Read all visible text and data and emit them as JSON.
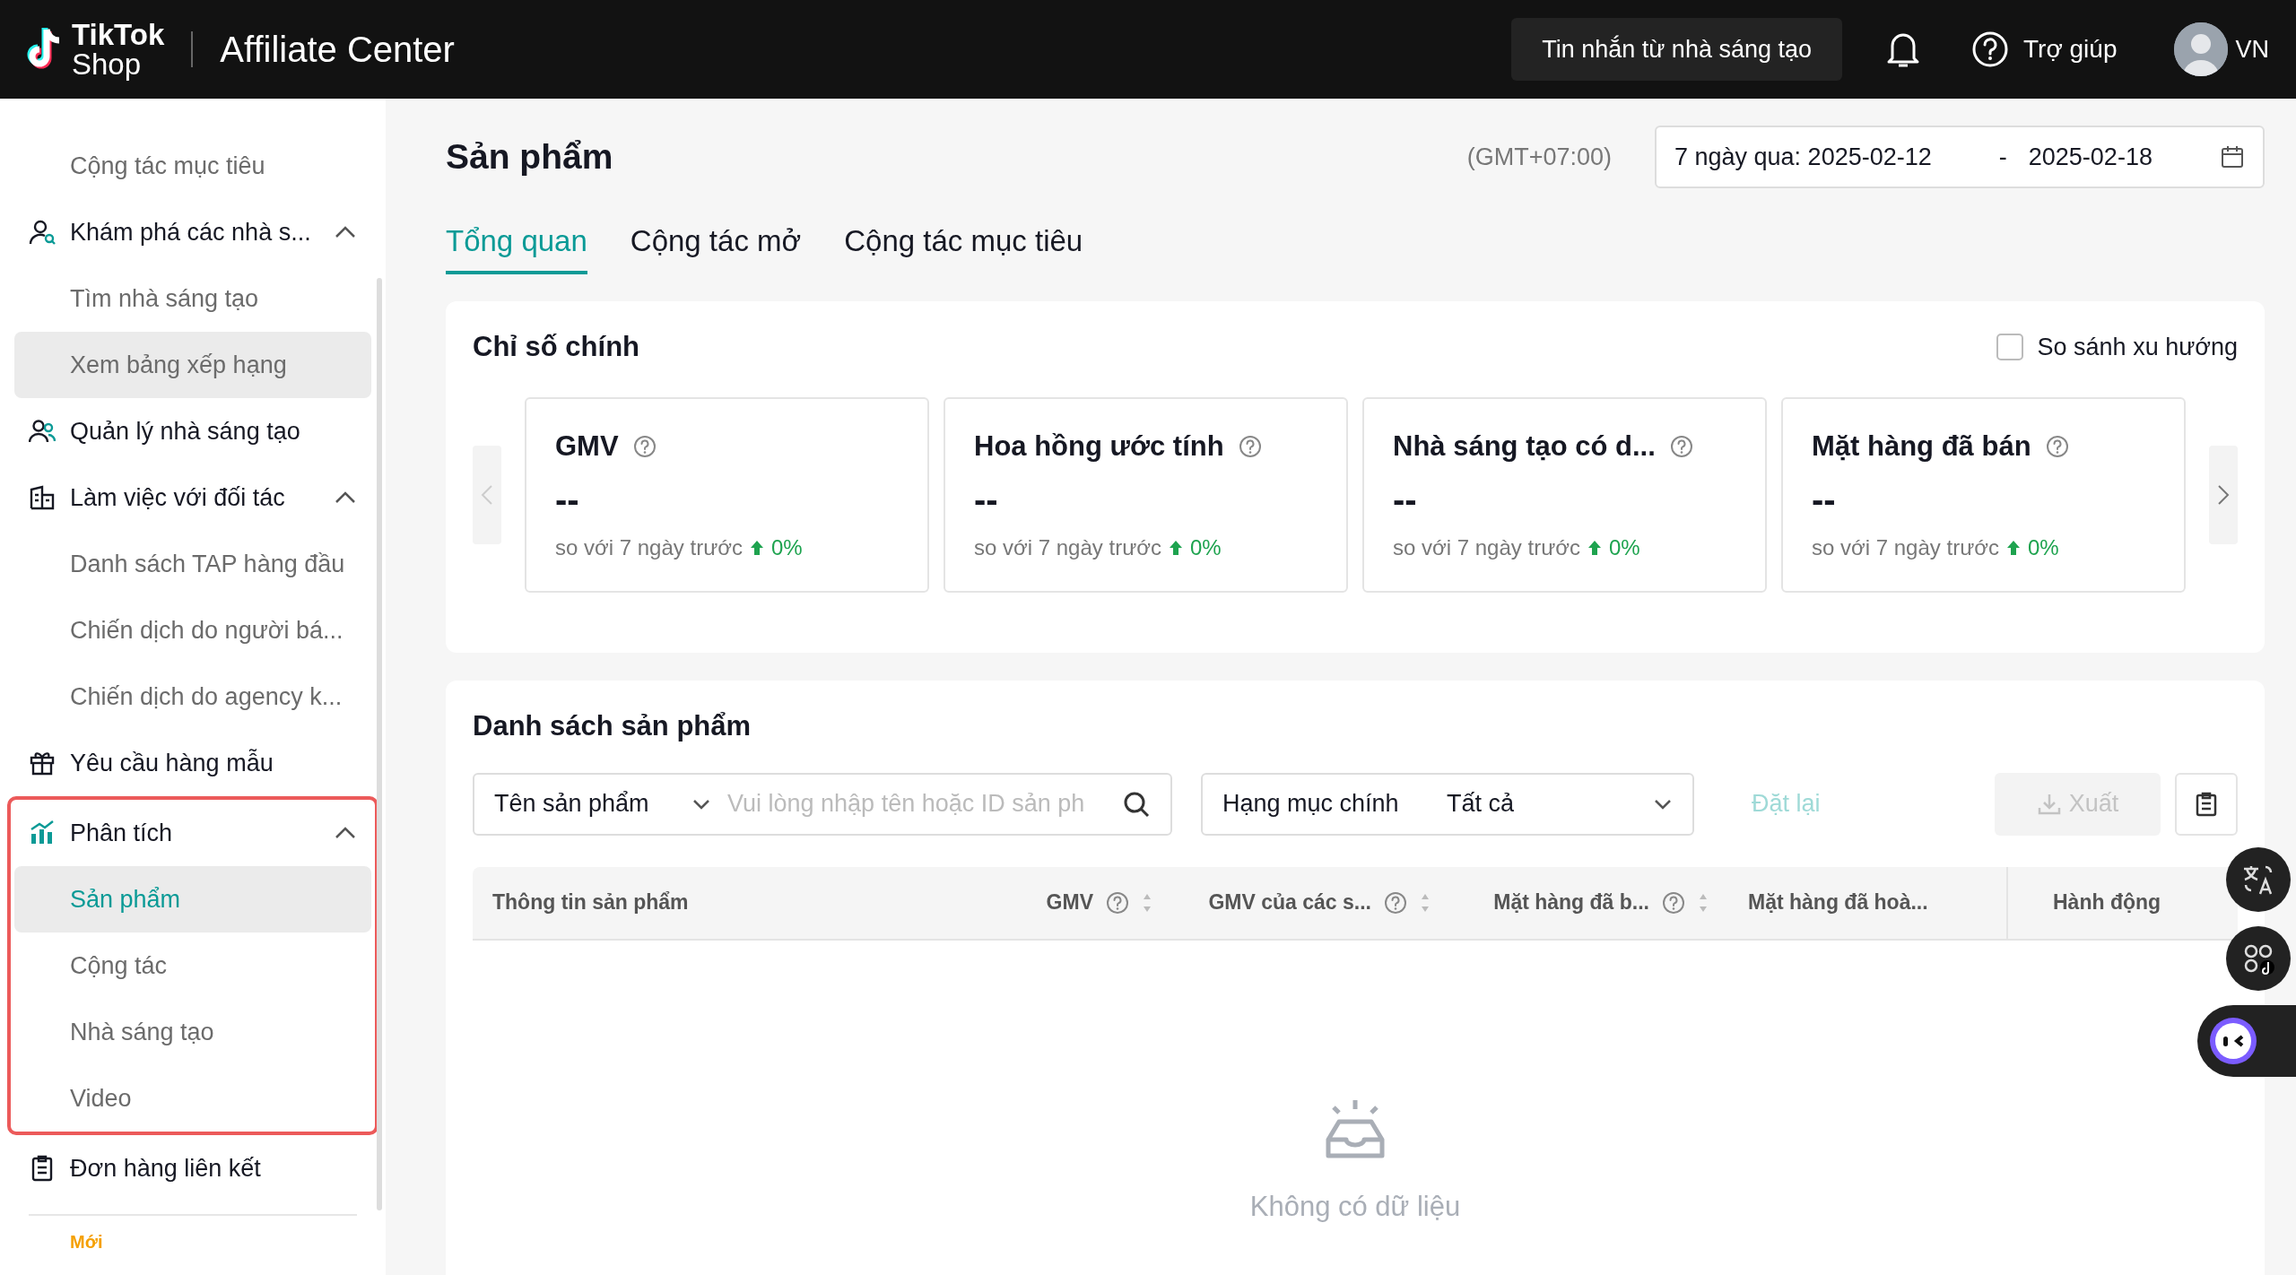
{
  "topbar": {
    "brand_top": "TikTok",
    "brand_bottom": "Shop",
    "app_title": "Affiliate Center",
    "messages_button": "Tin nhắn từ nhà sáng tạo",
    "help": "Trợ giúp",
    "region": "VN"
  },
  "sidebar": {
    "items": [
      {
        "kind": "sub",
        "label": "Cộng tác mục tiêu",
        "selected": false,
        "hovered": false
      },
      {
        "kind": "group",
        "label": "Khám phá các nhà s...",
        "expanded": true,
        "framed": false,
        "children": [
          {
            "label": "Tìm nhà sáng tạo",
            "selected": false,
            "hovered": false
          },
          {
            "label": "Xem bảng xếp hạng",
            "selected": false,
            "hovered": true
          }
        ]
      },
      {
        "kind": "link",
        "label": "Quản lý nhà sáng tạo"
      },
      {
        "kind": "group",
        "label": "Làm việc với đối tác",
        "expanded": true,
        "framed": false,
        "children": [
          {
            "label": "Danh sách TAP hàng đầu",
            "selected": false,
            "hovered": false
          },
          {
            "label": "Chiến dịch do người bá...",
            "selected": false,
            "hovered": false
          },
          {
            "label": "Chiến dịch do agency k...",
            "selected": false,
            "hovered": false
          }
        ]
      },
      {
        "kind": "link",
        "label": "Yêu cầu hàng mẫu"
      },
      {
        "kind": "group",
        "label": "Phân tích",
        "expanded": true,
        "framed": true,
        "children": [
          {
            "label": "Sản phẩm",
            "selected": true,
            "hovered": false
          },
          {
            "label": "Cộng tác",
            "selected": false,
            "hovered": false
          },
          {
            "label": "Nhà sáng tạo",
            "selected": false,
            "hovered": false
          },
          {
            "label": "Video",
            "selected": false,
            "hovered": false
          }
        ]
      },
      {
        "kind": "link",
        "label": "Đơn hàng liên kết"
      }
    ],
    "new_badge": "Mới"
  },
  "page": {
    "title": "Sản phẩm",
    "timezone": "(GMT+07:00)",
    "date_range": {
      "start": "7 ngày qua: 2025-02-12",
      "separator": "-",
      "end": "2025-02-18"
    }
  },
  "tabs": [
    {
      "label": "Tổng quan",
      "selected": true
    },
    {
      "label": "Cộng tác mở",
      "selected": false
    },
    {
      "label": "Cộng tác mục tiêu",
      "selected": false
    }
  ],
  "metrics": {
    "title": "Chỉ số chính",
    "compare_trend": {
      "label": "So sánh xu hướng",
      "checked": false
    },
    "prev_disabled": true,
    "next_disabled": false,
    "cards": [
      {
        "name": "GMV",
        "value": "--",
        "comparison": "so với 7 ngày trước",
        "rising": true,
        "change": "0%"
      },
      {
        "name": "Hoa hồng ước tính",
        "value": "--",
        "comparison": "so với 7 ngày trước",
        "rising": true,
        "change": "0%"
      },
      {
        "name": "Nhà sáng tạo có d...",
        "value": "--",
        "comparison": "so với 7 ngày trước",
        "rising": true,
        "change": "0%"
      },
      {
        "name": "Mặt hàng đã bán",
        "value": "--",
        "comparison": "so với 7 ngày trước",
        "rising": true,
        "change": "0%"
      }
    ]
  },
  "products": {
    "title": "Danh sách sản phẩm",
    "search_by": "Tên sản phẩm",
    "search": {
      "placeholder": "Vui lòng nhập tên hoặc ID sản ph"
    },
    "category": {
      "label": "Hạng mục chính",
      "value": "Tất cả"
    },
    "reset": {
      "label": "Đặt lại",
      "disabled": true
    },
    "export": {
      "label": "Xuất",
      "disabled": true
    },
    "columns": [
      {
        "label": "Thông tin sản phẩm",
        "help": false,
        "sortable": false
      },
      {
        "label": "GMV",
        "help": true,
        "sortable": true
      },
      {
        "label": "GMV của các s...",
        "help": true,
        "sortable": true
      },
      {
        "label": "Mặt hàng đã b...",
        "help": true,
        "sortable": true
      },
      {
        "label": "Mặt hàng đã hoà...",
        "help": false,
        "sortable": false
      },
      {
        "label": "Hành động",
        "help": false,
        "sortable": false
      }
    ],
    "empty": "Không có dữ liệu"
  }
}
